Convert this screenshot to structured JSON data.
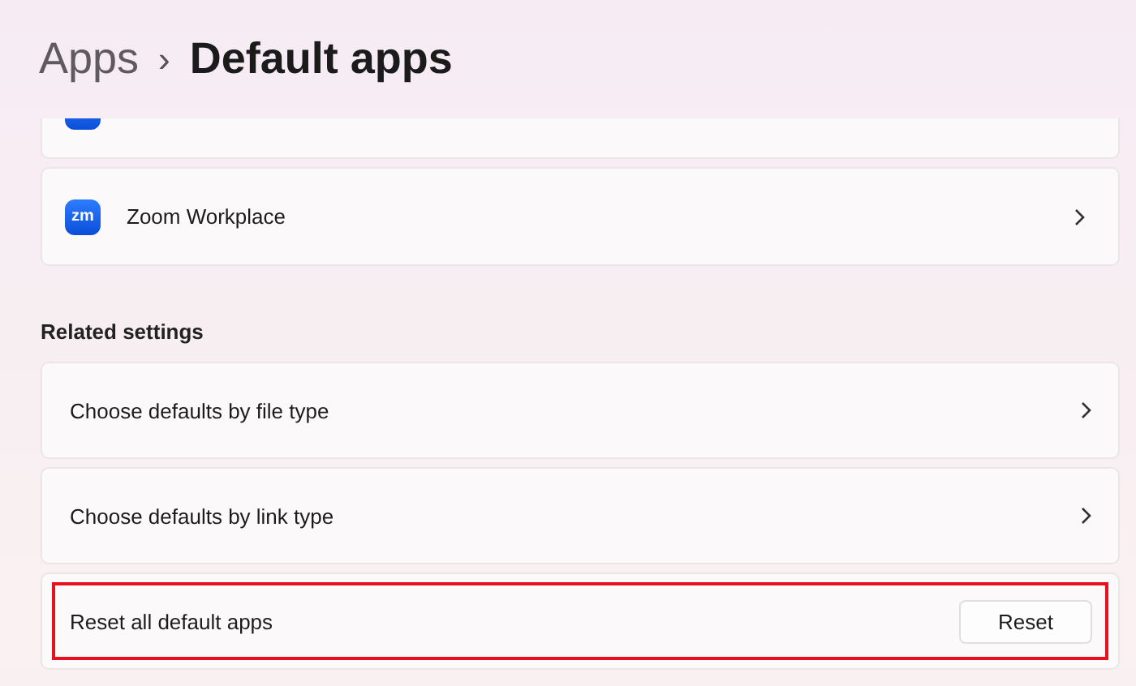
{
  "breadcrumb": {
    "parent": "Apps",
    "separator": "›",
    "current": "Default apps"
  },
  "apps": [
    {
      "clipped": true
    },
    {
      "clipped": false,
      "icon_text": "zm",
      "name": "Zoom Workplace"
    }
  ],
  "related_settings": {
    "heading": "Related settings",
    "items": [
      {
        "kind": "link",
        "label": "Choose defaults by file type",
        "highlighted": false
      },
      {
        "kind": "link",
        "label": "Choose defaults by link type",
        "highlighted": false
      },
      {
        "kind": "action",
        "label": "Reset all default apps",
        "button": "Reset",
        "highlighted": true
      }
    ]
  }
}
